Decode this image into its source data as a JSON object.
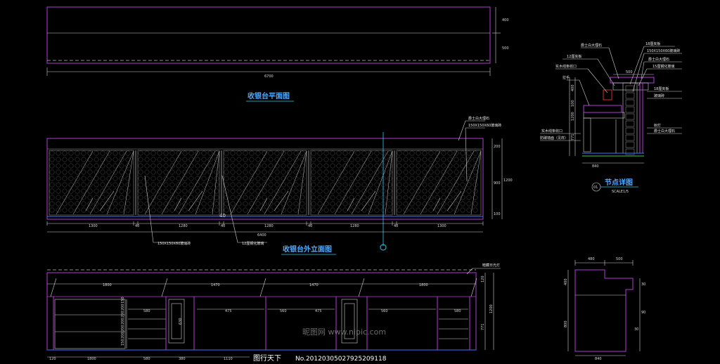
{
  "captions": {
    "plan": "收银台平面图",
    "elevation": "收银台外立面图",
    "detail": "节点详图",
    "detail_scale": "SCALE1/5",
    "detail_badge": "01"
  },
  "plan_dims": {
    "total": "6700",
    "h1": "400",
    "h2": "500"
  },
  "elevation_dims": {
    "segments": [
      "1300",
      "40",
      "1280",
      "40",
      "1280",
      "40",
      "1280",
      "40",
      "1300"
    ],
    "total": "6400",
    "mid": "40",
    "right_top": "200",
    "right_mid": "900",
    "right_bottom": "100",
    "right_total": "1200"
  },
  "elevation_notes": {
    "top_right_1": "爵士白大理石",
    "top_right_2": "150X150X60玻璃砖",
    "bottom_1": "150X150X60玻璃砖",
    "bottom_2": "12厘钢化玻璃"
  },
  "section_dims": {
    "top": [
      "1800",
      "1470",
      "1470",
      "1800"
    ],
    "inner": [
      "580",
      "475",
      "560",
      "475",
      "560",
      "580"
    ],
    "bottom": [
      "120",
      "1800",
      "580",
      "380",
      "1110",
      "120"
    ],
    "side": [
      "150",
      "200",
      "200",
      "200",
      "200",
      "200",
      "150"
    ],
    "right": [
      "120",
      "1200",
      "771"
    ],
    "drawer": "630",
    "note": "暗藏日光灯"
  },
  "detail_notes": [
    "爵士白大理石",
    "12厘夹板",
    "实木线条收口",
    "拉手",
    "实木线条收口",
    "防碳墙面（见样）",
    "18厘夹板",
    "150X150X60玻璃砖",
    "爵士白大理石",
    "15厘钢化玻璃",
    "18厘夹板",
    "玻璃砖",
    "射灯",
    "爵士白大理石"
  ],
  "detail_dims": {
    "top": "500",
    "left": [
      "400",
      "100",
      "1200",
      "771"
    ],
    "bottom": "840"
  },
  "profile_dims": {
    "top": [
      "480",
      "500"
    ],
    "left": [
      "400",
      "800"
    ],
    "right": [
      "30",
      "90",
      "30"
    ],
    "bottom": "840"
  },
  "watermark": "昵图网 www.nipic.com",
  "brand": "图行天下",
  "serial": "No.20120305027925209118"
}
